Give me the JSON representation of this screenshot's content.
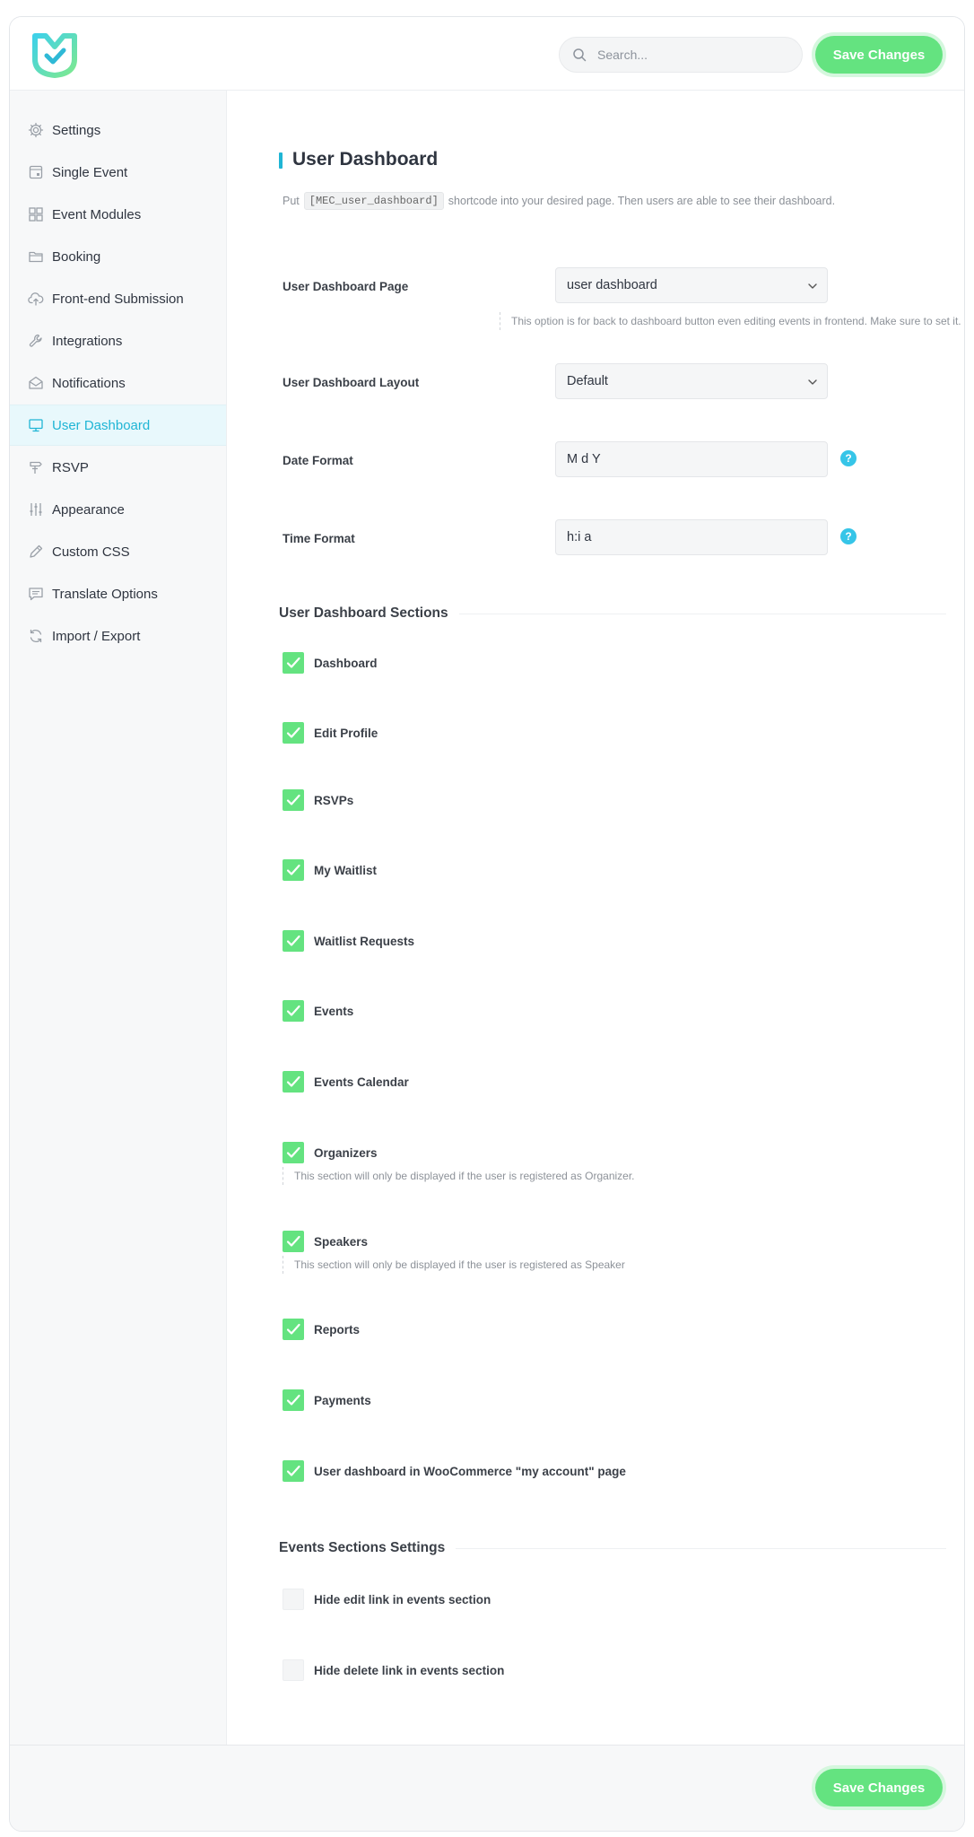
{
  "colors": {
    "accent": "#1fb5d5",
    "brand_green": "#64e380",
    "help_blue": "#36c5e8"
  },
  "header": {
    "logo_icon": "mec-logo-icon",
    "search": {
      "placeholder": "Search...",
      "value": ""
    },
    "save_label": "Save Changes"
  },
  "sidebar": {
    "items": [
      {
        "label": "Settings",
        "icon": "gear-icon"
      },
      {
        "label": "Single Event",
        "icon": "calendar-page-icon"
      },
      {
        "label": "Event Modules",
        "icon": "grid-icon"
      },
      {
        "label": "Booking",
        "icon": "folder-icon"
      },
      {
        "label": "Front-end Submission",
        "icon": "cloud-upload-icon"
      },
      {
        "label": "Integrations",
        "icon": "wrench-icon"
      },
      {
        "label": "Notifications",
        "icon": "envelope-icon"
      },
      {
        "label": "User Dashboard",
        "icon": "monitor-icon",
        "active": true
      },
      {
        "label": "RSVP",
        "icon": "signpost-icon"
      },
      {
        "label": "Appearance",
        "icon": "sliders-icon"
      },
      {
        "label": "Custom CSS",
        "icon": "pencil-icon"
      },
      {
        "label": "Translate Options",
        "icon": "message-icon"
      },
      {
        "label": "Import / Export",
        "icon": "refresh-icon"
      }
    ]
  },
  "main": {
    "title": "User Dashboard",
    "intro_before": "Put",
    "intro_code": "[MEC_user_dashboard]",
    "intro_after": "shortcode into your desired page. Then users are able to see their dashboard.",
    "dashboard_page": {
      "label": "User Dashboard Page",
      "value": "user dashboard",
      "note": "This option is for back to dashboard button even editing events in frontend. Make sure to set it."
    },
    "dashboard_layout": {
      "label": "User Dashboard Layout",
      "value": "Default"
    },
    "date_format": {
      "label": "Date Format",
      "value": "M d Y",
      "help": "?"
    },
    "time_format": {
      "label": "Time Format",
      "value": "h:i a",
      "help": "?"
    },
    "sections_title": "User Dashboard Sections",
    "sections": [
      {
        "label": "Dashboard",
        "checked": true
      },
      {
        "label": "Edit Profile",
        "checked": true
      },
      {
        "label": "RSVPs",
        "checked": true
      },
      {
        "label": "My Waitlist",
        "checked": true
      },
      {
        "label": "Waitlist Requests",
        "checked": true
      },
      {
        "label": "Events",
        "checked": true
      },
      {
        "label": "Events Calendar",
        "checked": true
      },
      {
        "label": "Organizers",
        "checked": true,
        "note": "This section will only be displayed if the user is registered as Organizer."
      },
      {
        "label": "Speakers",
        "checked": true,
        "note": "This section will only be displayed if the user is registered as Speaker"
      },
      {
        "label": "Reports",
        "checked": true
      },
      {
        "label": "Payments",
        "checked": true
      },
      {
        "label": "User dashboard in WooCommerce \"my account\" page",
        "checked": true
      }
    ],
    "events_settings_title": "Events Sections Settings",
    "events_settings": [
      {
        "label": "Hide edit link in events section",
        "checked": false
      },
      {
        "label": "Hide delete link in events section",
        "checked": false
      }
    ]
  },
  "footer": {
    "save_label": "Save Changes"
  }
}
